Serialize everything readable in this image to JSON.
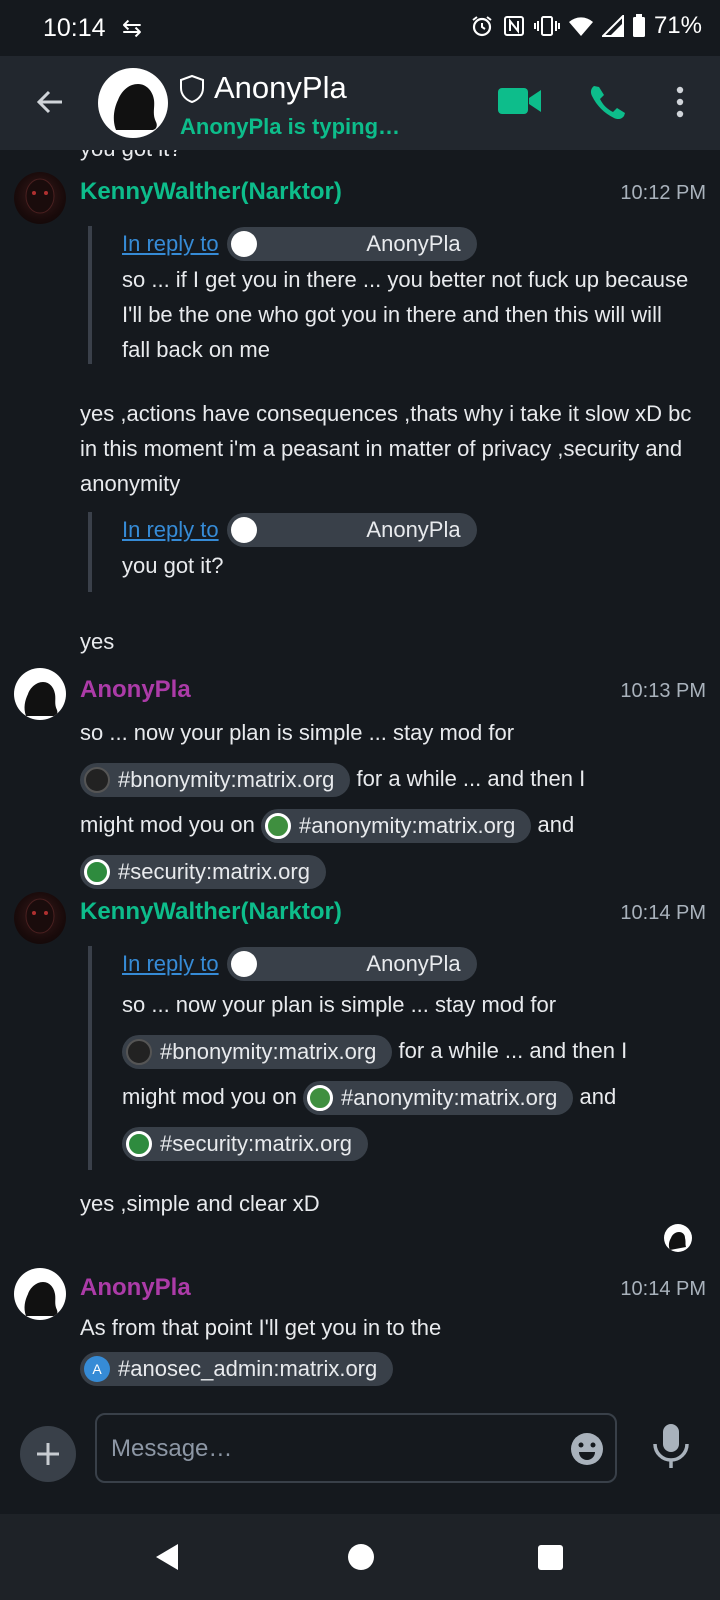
{
  "status_bar": {
    "time": "10:14",
    "battery": "71%",
    "icons": [
      "sync-icon",
      "alarm-icon",
      "nfc-icon",
      "vibrate-icon",
      "wifi-icon",
      "signal-icon",
      "battery-icon"
    ]
  },
  "header": {
    "room_name": "AnonyPla",
    "typing_status": "AnonyPla is typing…",
    "icons": [
      "back-arrow-icon",
      "shield-icon",
      "video-call-icon",
      "phone-icon",
      "more-vert-icon"
    ]
  },
  "timeline": {
    "partial_top_text": "you got it?",
    "messages": [
      {
        "sender": "KennyWalther(Narktor)",
        "time": "10:12 PM",
        "reply": {
          "link": "In reply to",
          "user": "AnonyPla",
          "text": "so ... if I get you in there ... you better not fuck up because I'll be the one who got you in there and then this will will fall back on me"
        },
        "text": "yes ,actions have consequences ,thats why i take it slow xD bc in this moment i'm a peasant in matter of privacy ,security and anonymity",
        "reply2": {
          "link": "In reply to",
          "user": "AnonyPla",
          "text": "you got it?"
        },
        "text2": "yes"
      },
      {
        "sender": "AnonyPla",
        "time": "10:13 PM",
        "text_a": "so ... now your plan is simple ... stay mod for",
        "room_1": "#bnonymity:matrix.org",
        "text_b": "for a while ... and then I",
        "text_c": "might mod you on",
        "room_2": "#anonymity:matrix.org",
        "text_d": "and",
        "room_3": "#security:matrix.org"
      },
      {
        "sender": "KennyWalther(Narktor)",
        "time": "10:14 PM",
        "reply": {
          "link": "In reply to",
          "user": "AnonyPla",
          "text_a": "so ... now your plan is simple ... stay mod for",
          "room_1": "#bnonymity:matrix.org",
          "text_b": "for a while ... and then I",
          "text_c": "might mod you on",
          "room_2": "#anonymity:matrix.org",
          "text_d": "and",
          "room_3": "#security:matrix.org"
        },
        "text": "yes ,simple and clear xD"
      },
      {
        "sender": "AnonyPla",
        "time": "10:14 PM",
        "text": "As from that point I'll get you in to the",
        "room": "#anosec_admin:matrix.org",
        "room_initial": "A"
      }
    ]
  },
  "composer": {
    "placeholder": "Message…",
    "icons": [
      "add-icon",
      "emoji-icon",
      "microphone-icon"
    ]
  },
  "colors": {
    "accent_green": "#0dbd8b",
    "anony_purple": "#ac3ba8",
    "link_blue": "#368bd6",
    "background": "#15191e",
    "header_bg": "#22272e"
  }
}
